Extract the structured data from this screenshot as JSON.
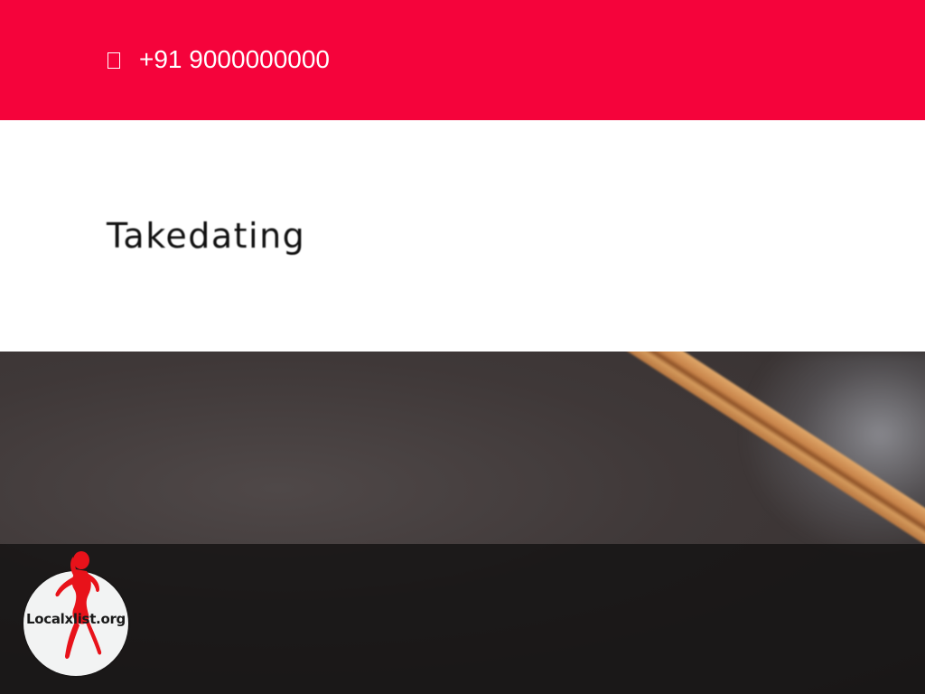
{
  "topbar": {
    "phone_icon": "phone-icon",
    "phone_number": "+91 9000000000",
    "background_color": "#f5033b"
  },
  "header": {
    "logo_text": "Takedating"
  },
  "badge": {
    "text": "Localxlist.org",
    "figure_color": "#e8121a"
  }
}
